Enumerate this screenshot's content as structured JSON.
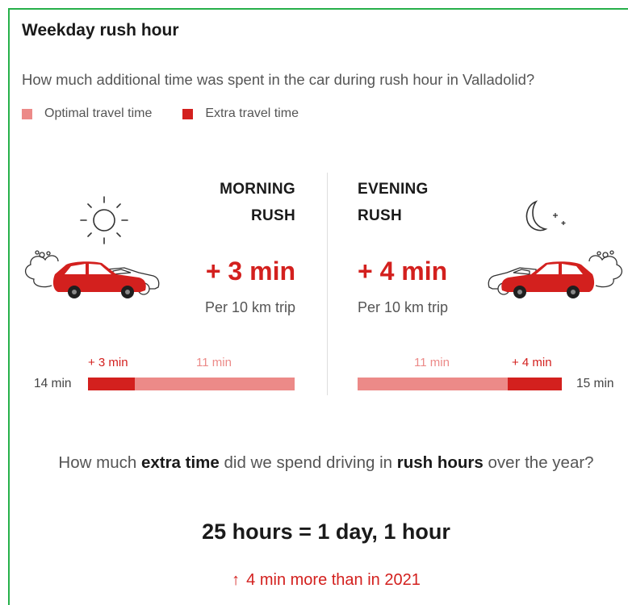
{
  "header": {
    "title": "Weekday rush hour",
    "question": "How much additional time was spent in the car during rush hour in Valladolid?"
  },
  "legend": {
    "optimal": {
      "label": "Optimal travel time",
      "color": "#ec8a88"
    },
    "extra": {
      "label": "Extra travel time",
      "color": "#d3201e"
    }
  },
  "morning": {
    "label_line1": "MORNING",
    "label_line2": "RUSH",
    "extra_time": "+ 3 min",
    "per_trip": "Per 10 km trip",
    "bar": {
      "extra_label": "+ 3 min",
      "optimal_label": "11 min",
      "total_label": "14 min",
      "extra_min": 3,
      "optimal_min": 11
    },
    "icon": "sun-icon"
  },
  "evening": {
    "label_line1": "EVENING",
    "label_line2": "RUSH",
    "extra_time": "+ 4 min",
    "per_trip": "Per 10 km trip",
    "bar": {
      "optimal_label": "11 min",
      "extra_label": "+ 4 min",
      "total_label": "15 min",
      "optimal_min": 11,
      "extra_min": 4
    },
    "icon": "moon-icon"
  },
  "yearly": {
    "q_part1": "How much ",
    "q_bold1": "extra time",
    "q_part2": " did we spend driving in ",
    "q_bold2": "rush hours",
    "q_part3": " over the year?",
    "total": "25 hours = 1 day, 1 hour",
    "comparison": "4 min more than in 2021",
    "arrow_icon": "arrow-up-icon"
  }
}
